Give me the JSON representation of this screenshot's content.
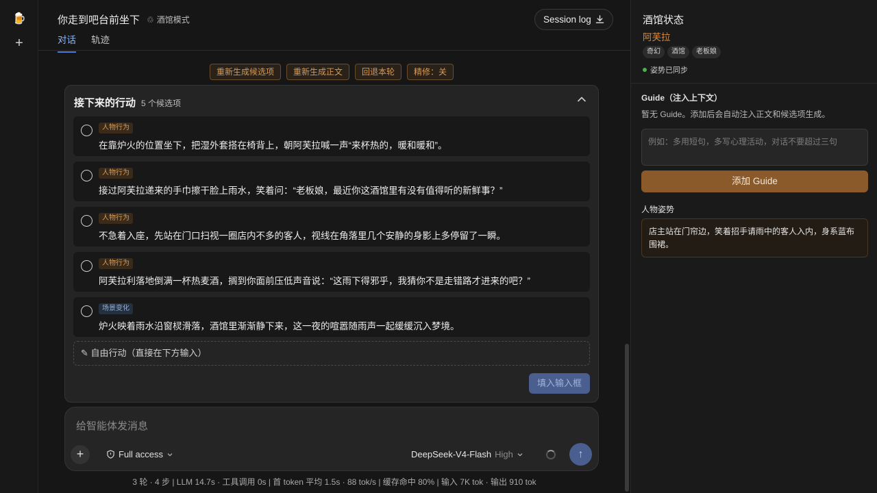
{
  "rail": {
    "logo": "🍺",
    "add": "+"
  },
  "header": {
    "title": "你走到吧台前坐下",
    "mode": "酒馆模式",
    "session_log": "Session log",
    "tabs": [
      "对话",
      "轨迹"
    ]
  },
  "actions": [
    "重新生成候选项",
    "重新生成正文",
    "回退本轮",
    "精修：关"
  ],
  "panel": {
    "title": "接下来的行动",
    "count": "5 个候选项",
    "options": [
      {
        "tag": "人物行为",
        "tag_type": "char",
        "text": "在靠炉火的位置坐下，把湿外套搭在椅背上，朝阿芙拉喊一声“来杯热的，暖和暖和”。"
      },
      {
        "tag": "人物行为",
        "tag_type": "char",
        "text": "接过阿芙拉递来的手巾擦干脸上雨水，笑着问：“老板娘，最近你这酒馆里有没有值得听的新鲜事？”"
      },
      {
        "tag": "人物行为",
        "tag_type": "char",
        "text": "不急着入座，先站在门口扫视一圈店内不多的客人，视线在角落里几个安静的身影上多停留了一瞬。"
      },
      {
        "tag": "人物行为",
        "tag_type": "char",
        "text": "阿芙拉利落地倒满一杯热麦酒，搁到你面前压低声音说：“这雨下得邪乎，我猜你不是走错路才进来的吧？”"
      },
      {
        "tag": "场景变化",
        "tag_type": "scene",
        "text": "炉火映着雨水沿窗棂滑落，酒馆里渐渐静下来，这一夜的喧嚣随雨声一起缓缓沉入梦境。"
      }
    ],
    "free_action": "✎ 自由行动（直接在下方输入）",
    "fill_button": "填入输入框"
  },
  "composer": {
    "placeholder": "给智能体发消息",
    "access": "Full access",
    "model": "DeepSeek-V4-Flash",
    "effort": "High"
  },
  "stats": "3 轮 · 4 步   |   LLM 14.7s · 工具调用 0s   |   首 token 平均 1.5s · 88 tok/s   |   缓存命中 80%   |   输入 7K tok · 输出 910 tok",
  "side": {
    "title": "酒馆状态",
    "name": "阿芙拉",
    "chips": [
      "奇幻",
      "酒馆",
      "老板娘"
    ],
    "sync": "姿势已同步",
    "guide_heading": "Guide（注入上下文）",
    "guide_empty": "暂无 Guide。添加后会自动注入正文和候选项生成。",
    "guide_placeholder": "例如：多用短句，多写心理活动，对话不要超过三句",
    "guide_add": "添加 Guide",
    "pose_heading": "人物姿势",
    "pose_text": "店主站在门帘边，笑着招手请雨中的客人入内，身系蓝布围裙。"
  }
}
